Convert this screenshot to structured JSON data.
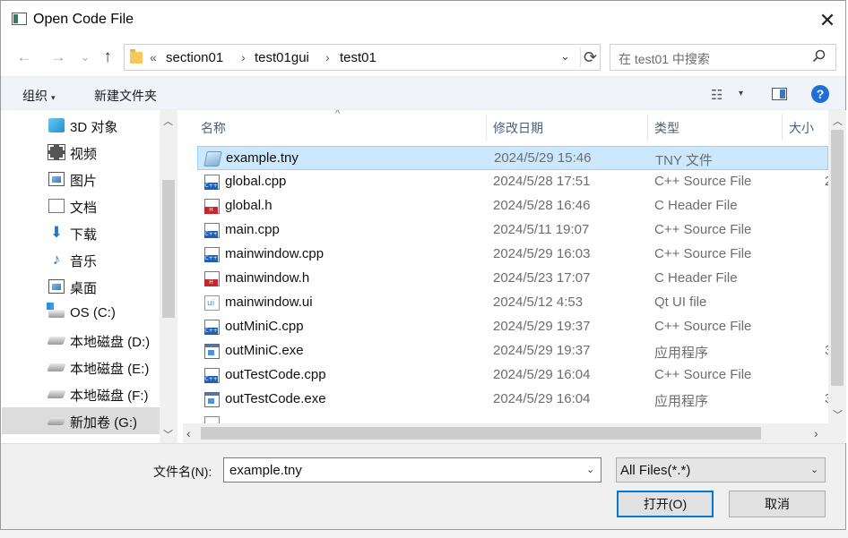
{
  "window": {
    "title": "Open Code File",
    "close_glyph": "✕"
  },
  "nav": {
    "back_glyph": "←",
    "forward_glyph": "→",
    "recent_glyph": "⌄",
    "up_glyph": "↑",
    "overflow": "«",
    "breadcrumbs": [
      "section01",
      "test01gui",
      "test01"
    ],
    "separator": "›",
    "dropdown_glyph": "⌄",
    "refresh_glyph": "⟳"
  },
  "search": {
    "placeholder": "在 test01 中搜索",
    "icon": "search-icon"
  },
  "toolbar": {
    "organize_label": "组织",
    "new_folder_label": "新建文件夹",
    "caret": "▾",
    "view_glyph": "☷",
    "help_glyph": "?"
  },
  "tree": {
    "items": [
      {
        "label": "3D 对象",
        "icon": "3d-objects-icon"
      },
      {
        "label": "视频",
        "icon": "video-icon"
      },
      {
        "label": "图片",
        "icon": "pictures-icon"
      },
      {
        "label": "文档",
        "icon": "documents-icon"
      },
      {
        "label": "下载",
        "icon": "downloads-icon"
      },
      {
        "label": "音乐",
        "icon": "music-icon"
      },
      {
        "label": "桌面",
        "icon": "desktop-icon"
      },
      {
        "label": "OS (C:)",
        "icon": "os-drive-icon"
      },
      {
        "label": "本地磁盘 (D:)",
        "icon": "drive-icon"
      },
      {
        "label": "本地磁盘 (E:)",
        "icon": "drive-icon"
      },
      {
        "label": "本地磁盘 (F:)",
        "icon": "drive-icon"
      },
      {
        "label": "新加卷 (G:)",
        "icon": "drive-icon",
        "selected": true
      }
    ]
  },
  "columns": {
    "name": "名称",
    "modified": "修改日期",
    "type": "类型",
    "size": "大小",
    "sort_glyph": "^"
  },
  "files": [
    {
      "name": "example.tny",
      "modified": "2024/5/29 15:46",
      "type": "TNY 文件",
      "size": "",
      "icon": "tny-file-icon",
      "selected": true
    },
    {
      "name": "global.cpp",
      "modified": "2024/5/28 17:51",
      "type": "C++ Source File",
      "size": "2",
      "icon": "cpp-file-icon"
    },
    {
      "name": "global.h",
      "modified": "2024/5/28 16:46",
      "type": "C Header File",
      "size": "",
      "icon": "header-file-icon"
    },
    {
      "name": "main.cpp",
      "modified": "2024/5/11 19:07",
      "type": "C++ Source File",
      "size": "",
      "icon": "cpp-file-icon"
    },
    {
      "name": "mainwindow.cpp",
      "modified": "2024/5/29 16:03",
      "type": "C++ Source File",
      "size": "",
      "icon": "cpp-file-icon"
    },
    {
      "name": "mainwindow.h",
      "modified": "2024/5/23 17:07",
      "type": "C Header File",
      "size": "",
      "icon": "header-file-icon"
    },
    {
      "name": "mainwindow.ui",
      "modified": "2024/5/12 4:53",
      "type": "Qt UI file",
      "size": "",
      "icon": "ui-file-icon"
    },
    {
      "name": "outMiniC.cpp",
      "modified": "2024/5/29 19:37",
      "type": "C++ Source File",
      "size": "",
      "icon": "cpp-file-icon"
    },
    {
      "name": "outMiniC.exe",
      "modified": "2024/5/29 19:37",
      "type": "应用程序",
      "size": "3",
      "icon": "exe-file-icon"
    },
    {
      "name": "outTestCode.cpp",
      "modified": "2024/5/29 16:04",
      "type": "C++ Source File",
      "size": "",
      "icon": "cpp-file-icon"
    },
    {
      "name": "outTestCode.exe",
      "modified": "2024/5/29 16:04",
      "type": "应用程序",
      "size": "3",
      "icon": "exe-file-icon"
    },
    {
      "name": "",
      "modified": "",
      "type": "",
      "size": "",
      "icon": "text-file-icon"
    }
  ],
  "scroll": {
    "up": "︿",
    "down": "﹀",
    "left": "‹",
    "right": "›"
  },
  "footer": {
    "filename_label": "文件名(N):",
    "filename_value": "example.tny",
    "filter_value": "All Files(*.*)",
    "caret": "⌄",
    "open_label": "打开(O)",
    "cancel_label": "取消"
  }
}
